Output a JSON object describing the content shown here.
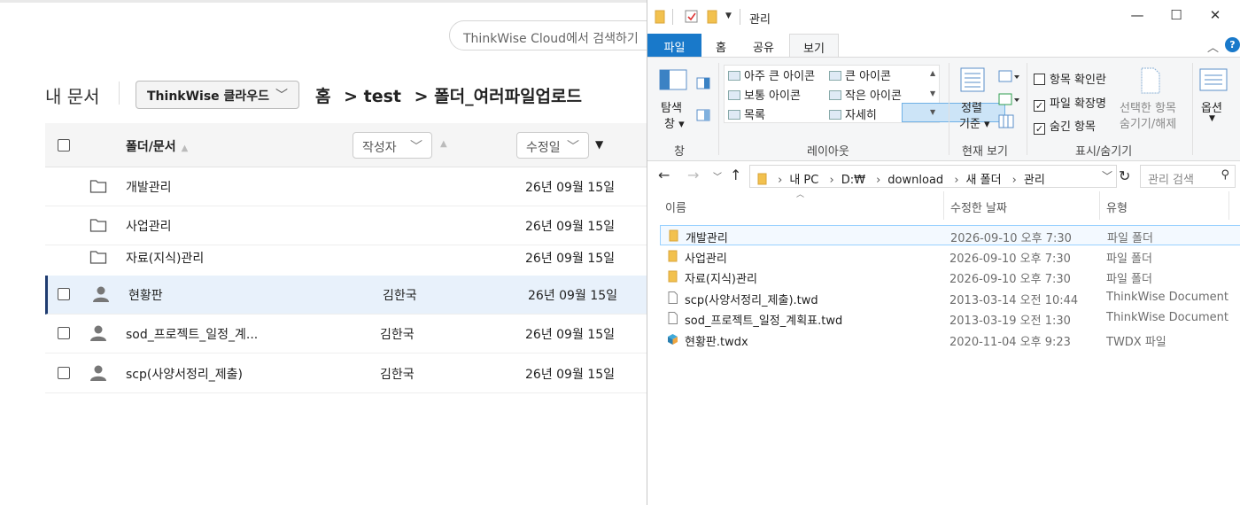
{
  "web": {
    "search_placeholder": "ThinkWise Cloud에서 검색하기",
    "title": "내 문서",
    "cloud_button": "ThinkWise 클라우드",
    "breadcrumb": [
      "홈",
      "> test",
      "> 폴더_여러파일업로드"
    ],
    "columns": {
      "name": "폴더/문서",
      "author": "작성자",
      "date": "수정일"
    },
    "rows": [
      {
        "type": "folder",
        "name": "개발관리",
        "author": "",
        "date": "26년 09월 15일",
        "selected": false
      },
      {
        "type": "folder",
        "name": "사업관리",
        "author": "",
        "date": "26년 09월 15일",
        "selected": false
      },
      {
        "type": "folder",
        "name": "자료(지식)관리",
        "author": "",
        "date": "26년 09월 15일",
        "selected": false
      },
      {
        "type": "doc",
        "name": "현황판",
        "author": "김한국",
        "date": "26년 09월 15일",
        "selected": true
      },
      {
        "type": "doc",
        "name": "sod_프로젝트_일정_계...",
        "author": "김한국",
        "date": "26년 09월 15일",
        "selected": false
      },
      {
        "type": "doc",
        "name": "scp(사양서정리_제출)",
        "author": "김한국",
        "date": "26년 09월 15일",
        "selected": false
      }
    ]
  },
  "explorer": {
    "window_title": "관리",
    "tabs": [
      "파일",
      "홈",
      "공유",
      "보기"
    ],
    "ribbon": {
      "pane_label": "탐색",
      "pane_label2": "창",
      "group_pane": "창",
      "layout_items": [
        "아주 큰 아이콘",
        "큰 아이콘",
        "보통 아이콘",
        "작은 아이콘",
        "목록",
        "자세히"
      ],
      "group_layout": "레이아웃",
      "sort_label": "정렬",
      "sort_label2": "기준",
      "group_current": "현재 보기",
      "checkboxes": [
        {
          "label": "항목 확인란",
          "checked": false
        },
        {
          "label": "파일 확장명",
          "checked": true
        },
        {
          "label": "숨긴 항목",
          "checked": true
        }
      ],
      "hide_selected": "선택한 항목",
      "hide_selected2": "숨기기/해제",
      "group_showhide": "표시/숨기기",
      "options": "옵션"
    },
    "address": [
      "내 PC",
      "D:₩",
      "download",
      "새 폴더",
      "관리"
    ],
    "search_placeholder": "관리 검색",
    "columns": {
      "name": "이름",
      "date": "수정한 날짜",
      "type": "유형"
    },
    "files": [
      {
        "icon": "folder",
        "name": "개발관리",
        "date": "2026-09-10 오후 7:30",
        "type": "파일 폴더",
        "highlight": true
      },
      {
        "icon": "folder",
        "name": "사업관리",
        "date": "2026-09-10 오후 7:30",
        "type": "파일 폴더",
        "highlight": false
      },
      {
        "icon": "folder",
        "name": "자료(지식)관리",
        "date": "2026-09-10 오후 7:30",
        "type": "파일 폴더",
        "highlight": false
      },
      {
        "icon": "document",
        "name": "scp(사양서정리_제출).twd",
        "date": "2013-03-14 오전 10:44",
        "type": "ThinkWise Document",
        "highlight": false
      },
      {
        "icon": "document",
        "name": "sod_프로젝트_일정_계획표.twd",
        "date": "2013-03-19 오전 1:30",
        "type": "ThinkWise Document",
        "highlight": false
      },
      {
        "icon": "twdx",
        "name": "현황판.twdx",
        "date": "2020-11-04 오후 9:23",
        "type": "TWDX 파일",
        "highlight": false
      }
    ]
  },
  "colors": {
    "accent": "#1979ca",
    "selected_row": "#e8f1fb",
    "selected_bar": "#1f3c70",
    "folder": "#f2c14e"
  }
}
